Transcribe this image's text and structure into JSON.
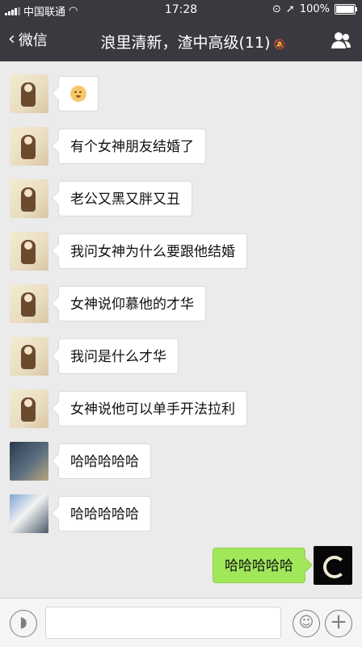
{
  "status": {
    "carrier": "中国联通",
    "time": "17:28",
    "battery": "100%"
  },
  "nav": {
    "back_label": "微信",
    "title": "浪里清新，渣中高级(11)"
  },
  "messages": [
    {
      "from": "other",
      "text": "",
      "emoji": "smiley"
    },
    {
      "from": "other",
      "text": "有个女神朋友结婚了"
    },
    {
      "from": "other",
      "text": "老公又黑又胖又丑"
    },
    {
      "from": "other",
      "text": "我问女神为什么要跟他结婚"
    },
    {
      "from": "other",
      "text": "女神说仰慕他的才华"
    },
    {
      "from": "other",
      "text": "我问是什么才华"
    },
    {
      "from": "other",
      "text": "女神说他可以单手开法拉利"
    },
    {
      "from": "other",
      "text": "哈哈哈哈哈"
    },
    {
      "from": "other",
      "text": "哈哈哈哈哈"
    },
    {
      "from": "me",
      "text": "哈哈哈哈哈"
    }
  ],
  "input": {
    "placeholder": ""
  },
  "colors": {
    "nav_bg": "#393a3f",
    "chat_bg": "#ebebeb",
    "my_bubble": "#a0e75a"
  }
}
